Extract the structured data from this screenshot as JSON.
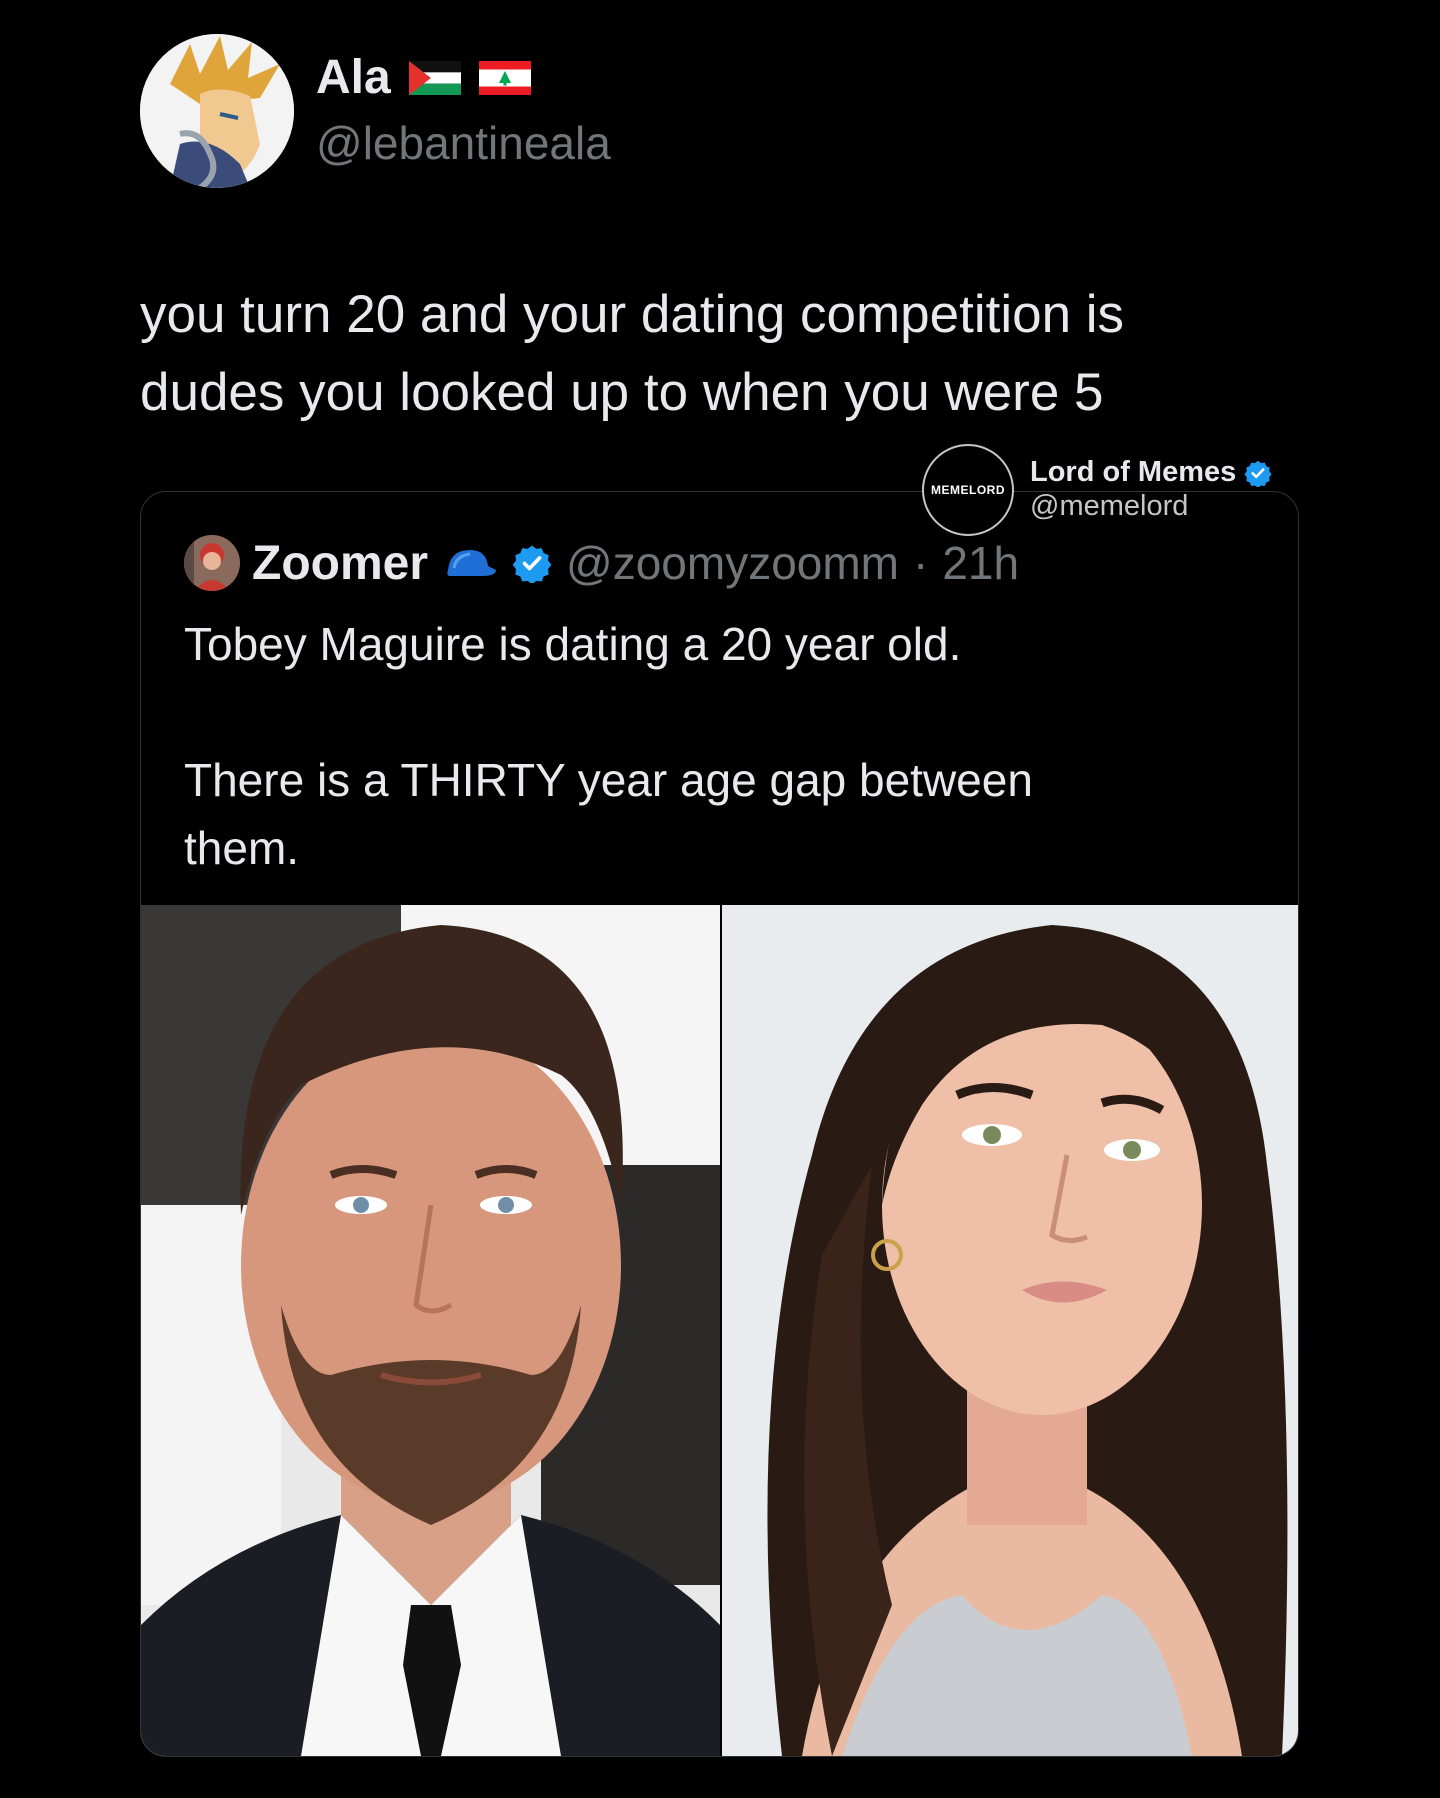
{
  "main_tweet": {
    "display_name": "Ala",
    "handle": "@lebantineala",
    "flags": [
      "palestine-flag-icon",
      "lebanon-flag-icon"
    ],
    "text_lines": [
      "you turn 20 and your dating competition is",
      "dudes you looked up to when you were 5"
    ]
  },
  "watermark": {
    "logo_text": "MEMELORD",
    "name": "Lord of Memes",
    "handle": "@memelord",
    "verified": true
  },
  "quoted_tweet": {
    "display_name": "Zoomer",
    "handle": "@zoomyzoomm",
    "separator": "·",
    "time": "21h",
    "verified": true,
    "text_lines": [
      "Tobey Maguire is dating a 20 year old.",
      "There is a THIRTY year age gap between",
      "them."
    ]
  },
  "colors": {
    "background": "#000000",
    "text_primary": "#e7e9ea",
    "text_secondary": "#71767b",
    "verified_blue": "#1d9bf0",
    "card_border": "#2f3336"
  }
}
